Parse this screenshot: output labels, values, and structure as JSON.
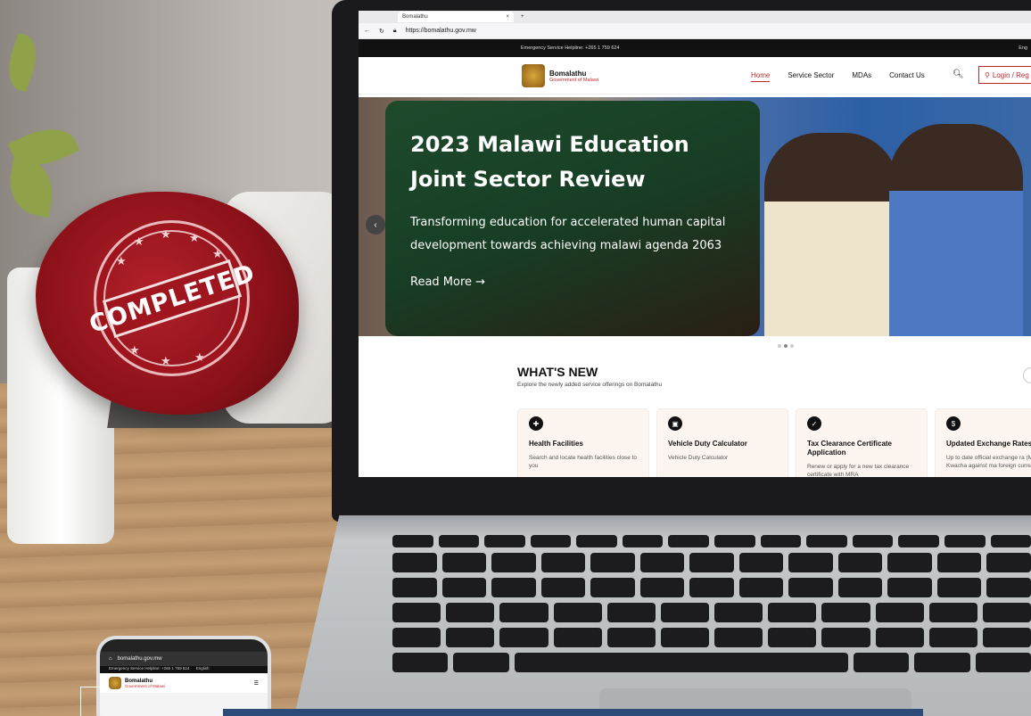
{
  "browser": {
    "tab_title": "Bomalathu",
    "tab_close": "×",
    "new_tab": "+",
    "url": "https://bomalathu.gov.mw"
  },
  "site": {
    "helpline": "Emergency Service Helpline: +265 1 759 624",
    "lang": "Eng",
    "brand_name": "Bomalathu",
    "brand_sub": "Government of Malawi",
    "nav": [
      "Home",
      "Service Sector",
      "MDAs",
      "Contact Us"
    ],
    "login": "Login / Reg"
  },
  "hero": {
    "title": "2023 Malawi Education Joint Sector Review",
    "body": "Transforming education for accelerated  human capital development towards achieving malawi agenda 2063",
    "cta": "Read More →",
    "prev": "‹"
  },
  "whats_new": {
    "heading": "WHAT'S NEW",
    "subtitle": "Explore the newly added service offerings on Bomalathu",
    "cards": [
      {
        "title": "Health Facilities",
        "desc": "Search and locate health facilities close to you"
      },
      {
        "title": "Vehicle Duty Calculator",
        "desc": "Vehicle Duty Calculator"
      },
      {
        "title": "Tax Clearance Certificate Application",
        "desc": "Renew or apply for a new tax clearance certificate with MRA"
      },
      {
        "title": "Updated Exchange Rates",
        "desc": "Up to date official exchange ra (Malawian Kwacha against ma foreign currencies)"
      }
    ]
  },
  "seal": {
    "text": "COMPLETED"
  },
  "phone": {
    "url": "bomalathu.gov.mw",
    "helpline": "Emergency Service Helpline: +265 1 759 624",
    "lang": "English",
    "brand_name": "Bomalathu",
    "brand_sub": "Government of Malawi"
  },
  "colors": {
    "accent": "#c0282d",
    "hero_card": "#1e4a2c",
    "seal": "#8b1119"
  }
}
